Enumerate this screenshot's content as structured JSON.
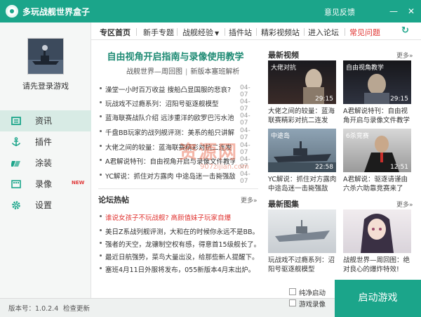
{
  "app": {
    "title": "多玩战舰世界盒子",
    "feedback": "意见反馈",
    "minimize_glyph": "—",
    "close_glyph": "✕"
  },
  "sidebar": {
    "login_text": "请先登录游戏",
    "items": [
      {
        "label": "资讯",
        "icon": "news-icon",
        "active": true
      },
      {
        "label": "插件",
        "icon": "anchor-icon",
        "active": false
      },
      {
        "label": "涂装",
        "icon": "paint-icon",
        "active": false
      },
      {
        "label": "录像",
        "icon": "video-icon",
        "active": false,
        "badge": "NEW"
      },
      {
        "label": "设置",
        "icon": "gear-icon",
        "active": false
      }
    ]
  },
  "tabs": [
    {
      "label": "专区首页",
      "active": true
    },
    {
      "label": "新手专题"
    },
    {
      "label": "战舰经验",
      "dropdown": true
    },
    {
      "label": "插件站"
    },
    {
      "label": "精彩视频站"
    },
    {
      "label": "进入论坛"
    },
    {
      "label": "常见问题",
      "highlight": true
    }
  ],
  "main": {
    "headline": "自由视角开启指南与录像使用教学",
    "sublinks": [
      "战舰世界—周回图",
      "新版本塞班解析"
    ],
    "news": [
      {
        "title": "澡堂一小时百万收益 搜船凸显国服的悲哀?",
        "date": "04-07"
      },
      {
        "title": "玩战戏不过瘾系列：沼阳号驱逐舰模型",
        "date": "04-07"
      },
      {
        "title": "蓝海联赛战队介绍 远涉重洋的欧罗巴污水池",
        "date": "04-07"
      },
      {
        "title": "千盘BB玩家的战列舰评测：美系的船只讲解",
        "date": "04-07"
      },
      {
        "title": "大佬之间的较量：蓝海联赛精彩对抗二连发",
        "date": "04-07"
      },
      {
        "title": "A君解说特刊：自由视角开启与录像文件教学",
        "date": "04-07"
      },
      {
        "title": "YC解说：抓住对方露肉 中途岛迷一击毙强敌",
        "date": "04-07"
      }
    ],
    "forum": {
      "title": "论坛热帖",
      "more": "更多»",
      "posts": [
        {
          "title": "谁说女孩子不玩战舰? 高颜值妹子玩家自爆",
          "hot": true
        },
        {
          "title": "美日Z系战列舰评测，大和在的时候你永远不是BB。"
        },
        {
          "title": "强者的天空，龙骧制空权有感，得意首15级舰长了。"
        },
        {
          "title": "最近日航强势，菜鸟大量出没，给那些新人提醒下。"
        },
        {
          "title": "塞班4月11日外服将发布，055新版本4月末出炉。"
        }
      ]
    }
  },
  "right": {
    "videos_title": "最新视频",
    "videos_more": "更多»",
    "videos": [
      {
        "badge": "大佬对抗",
        "duration": "29:15",
        "caption": "大佬之间的较量：蓝海联赛精彩对抗二连发",
        "style": "dark-figure"
      },
      {
        "badge": "自由视角教学",
        "duration": "29:15",
        "caption": "A君解说特刊：自由视角开启与录像文件教学",
        "style": "dark-figure"
      },
      {
        "badge": "中途岛",
        "duration": "22:58",
        "caption": "YC解说：抓住对方露肉中途岛迷一击毙强敌",
        "style": "ship"
      },
      {
        "badge": "6杀竞赛",
        "duration": "12:51",
        "caption": "A君解说：驱逐请谨由六杀六助靠竞赛来了",
        "style": "hitman"
      }
    ],
    "images_title": "最新图集",
    "images_more": "更多»",
    "images": [
      {
        "caption": "玩战戏不过瘾系列：沼阳号驱逐舰模型",
        "style": "model"
      },
      {
        "caption": "战舰世界—周回图：绝对良心的爆炸特效!",
        "style": "anime"
      }
    ]
  },
  "watermark": {
    "text": "资源网",
    "url": "907zijian.com"
  },
  "bottom": {
    "version": "版本号：1.0.2.4",
    "check_update": "检查更新",
    "opt_autostart": "纯净启动",
    "opt_record": "游戏录像",
    "launch": "启动游戏"
  },
  "colors": {
    "accent": "#1ba58a",
    "red": "#e0322f"
  }
}
